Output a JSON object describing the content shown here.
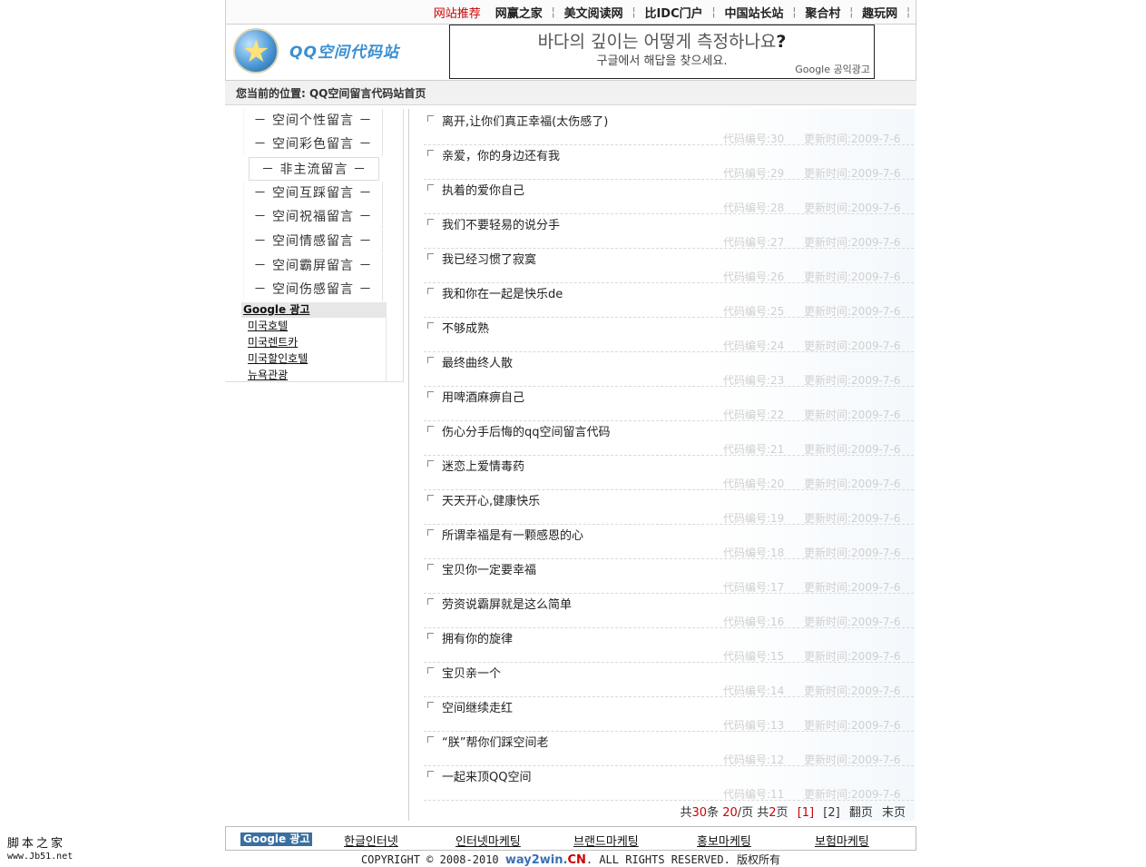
{
  "topbar": {
    "links": [
      "网站推荐",
      "网赢之家",
      "美文阅读网",
      "比IDC门户",
      "中国站长站",
      "聚合村",
      "趣玩网"
    ]
  },
  "header": {
    "logo_text": "QQ空间代码站",
    "ad_title": "바다의 깊이는 어떻게 측정하나요",
    "ad_title_mark": "?",
    "ad_sub": "구글에서 해답을 찾으세요.",
    "ad_foot": "Google 공익광고"
  },
  "breadcrumb": "您当前的位置: QQ空间留言代码站首页",
  "sidebar": {
    "items": [
      "－ 空间个性留言 －",
      "－ 空间彩色留言 －",
      "－ 非主流留言 －",
      "－ 空间互踩留言 －",
      "－ 空间祝福留言 －",
      "－ 空间情感留言 －",
      "－ 空间霸屏留言 －",
      "－ 空间伤感留言 －"
    ],
    "ad_head": "Google 광고",
    "ad_links": [
      "미국호텔",
      "미국렌트카",
      "미국할인호텔",
      "뉴욕관광"
    ]
  },
  "list": {
    "code_label": "代码编号:",
    "time_label": "更新时间:",
    "items": [
      {
        "title": "离开,让你们真正幸福(太伤感了)",
        "code": "30",
        "time": "2009-7-6"
      },
      {
        "title": "亲爱，你的身边还有我",
        "code": "29",
        "time": "2009-7-6"
      },
      {
        "title": "执着的爱你自己",
        "code": "28",
        "time": "2009-7-6"
      },
      {
        "title": "我们不要轻易的说分手",
        "code": "27",
        "time": "2009-7-6"
      },
      {
        "title": "我已经习惯了寂寞",
        "code": "26",
        "time": "2009-7-6"
      },
      {
        "title": "我和你在一起是快乐de",
        "code": "25",
        "time": "2009-7-6"
      },
      {
        "title": "不够成熟",
        "code": "24",
        "time": "2009-7-6"
      },
      {
        "title": "最终曲终人散",
        "code": "23",
        "time": "2009-7-6"
      },
      {
        "title": "用啤酒麻痹自己",
        "code": "22",
        "time": "2009-7-6"
      },
      {
        "title": "伤心分手后悔的qq空间留言代码",
        "code": "21",
        "time": "2009-7-6"
      },
      {
        "title": "迷恋上爱情毒药",
        "code": "20",
        "time": "2009-7-6"
      },
      {
        "title": "天天开心,健康快乐",
        "code": "19",
        "time": "2009-7-6"
      },
      {
        "title": "所谓幸福是有一颗感恩的心",
        "code": "18",
        "time": "2009-7-6"
      },
      {
        "title": "宝贝你一定要幸福",
        "code": "17",
        "time": "2009-7-6"
      },
      {
        "title": "劳资说霸屏就是这么简单",
        "code": "16",
        "time": "2009-7-6"
      },
      {
        "title": "拥有你的旋律",
        "code": "15",
        "time": "2009-7-6"
      },
      {
        "title": "宝贝亲一个",
        "code": "14",
        "time": "2009-7-6"
      },
      {
        "title": "空间继续走红",
        "code": "13",
        "time": "2009-7-6"
      },
      {
        "title": "“朕”帮你们踩空间老",
        "code": "12",
        "time": "2009-7-6"
      },
      {
        "title": "一起来顶QQ空间",
        "code": "11",
        "time": "2009-7-6"
      }
    ]
  },
  "pager": {
    "prefix": "共",
    "total": "30",
    "mid1": "条 ",
    "per": "20",
    "mid2": "/页 共",
    "pages": "2",
    "mid3": "页",
    "page1": "[1]",
    "page2": "[2]",
    "next": "翻页",
    "last": "末页"
  },
  "footer": {
    "ad_head": "Google 광고",
    "links": [
      "한글인터넷",
      "인터넷마케팅",
      "브랜드마케팅",
      "홍보마케팅",
      "보험마케팅"
    ],
    "copyright_pre": "COPYRIGHT © 2008-2010 ",
    "brand_main": "way2win.",
    "brand_cn": "CN",
    "copyright_post": ". ALL RIGHTS RESERVED. 版权所有"
  },
  "watermark": {
    "line1": "脚本之家",
    "line2": "www.Jb51.net"
  }
}
